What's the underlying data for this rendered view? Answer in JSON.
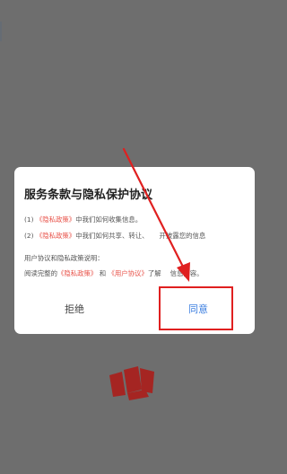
{
  "dialog": {
    "title": "服务条款与隐私保护协议",
    "line1": {
      "prefix": "(1)",
      "link": "《隐私政策》",
      "suffix": "中我们如何收集信息。"
    },
    "line2": {
      "prefix": "(2)",
      "link": "《隐私政策》",
      "suffix": "中我们如何共享、转让、",
      "tail": "开披露您的信息"
    },
    "line3": "用户协议和隐私政策说明：",
    "line4": {
      "prefix": "阅读完整的",
      "link1": "《隐私政策》",
      "and": "和",
      "link2": "《用户协议》",
      "suffix": "了解",
      "tail": "信息内容。"
    },
    "reject_label": "拒绝",
    "agree_label": "同意"
  },
  "colors": {
    "overlay": "#6e6e6e",
    "link": "#e8534a",
    "agree": "#3d7fe0",
    "annotation": "#e02020",
    "logo": "#a52522"
  },
  "icons": {
    "logo": "app-logo-icon",
    "annotation_arrow": "annotation-arrow"
  }
}
